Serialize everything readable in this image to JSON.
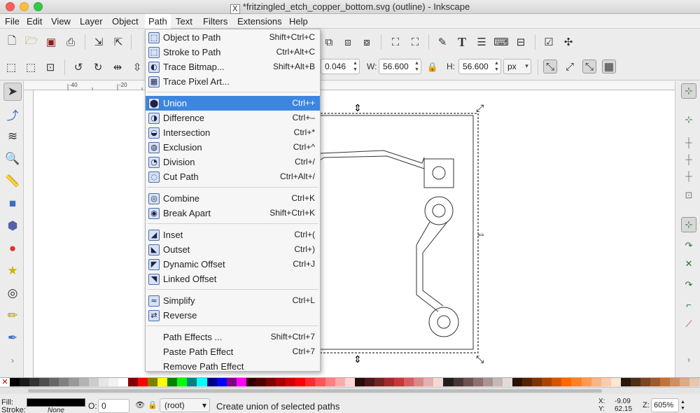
{
  "window": {
    "title": "*fritzingled_etch_copper_bottom.svg (outline) - Inkscape",
    "x11_glyph": "X",
    "traffic_colors": [
      "#fc605c",
      "#fdbc40",
      "#34c84a"
    ]
  },
  "menubar": [
    "File",
    "Edit",
    "View",
    "Layer",
    "Object",
    "Path",
    "Text",
    "Filters",
    "Extensions",
    "Help"
  ],
  "path_menu": {
    "items": [
      {
        "label": "Object to Path",
        "accel": "Shift+Ctrl+C",
        "icon": "object-to-path-icon"
      },
      {
        "label": "Stroke to Path",
        "accel": "Ctrl+Alt+C",
        "icon": "stroke-to-path-icon"
      },
      {
        "label": "Trace Bitmap...",
        "accel": "Shift+Alt+B",
        "icon": "trace-bitmap-icon"
      },
      {
        "label": "Trace Pixel Art...",
        "accel": "",
        "icon": "trace-pixel-art-icon"
      },
      {
        "label": "Union",
        "accel": "Ctrl++",
        "icon": "union-icon"
      },
      {
        "label": "Difference",
        "accel": "Ctrl+–",
        "icon": "difference-icon"
      },
      {
        "label": "Intersection",
        "accel": "Ctrl+*",
        "icon": "intersection-icon"
      },
      {
        "label": "Exclusion",
        "accel": "Ctrl+^",
        "icon": "exclusion-icon"
      },
      {
        "label": "Division",
        "accel": "Ctrl+/",
        "icon": "division-icon"
      },
      {
        "label": "Cut Path",
        "accel": "Ctrl+Alt+/",
        "icon": "cut-path-icon"
      },
      {
        "label": "Combine",
        "accel": "Ctrl+K",
        "icon": "combine-icon"
      },
      {
        "label": "Break Apart",
        "accel": "Shift+Ctrl+K",
        "icon": "break-apart-icon"
      },
      {
        "label": "Inset",
        "accel": "Ctrl+(",
        "icon": "inset-icon"
      },
      {
        "label": "Outset",
        "accel": "Ctrl+)",
        "icon": "outset-icon"
      },
      {
        "label": "Dynamic Offset",
        "accel": "Ctrl+J",
        "icon": "dynamic-offset-icon"
      },
      {
        "label": "Linked Offset",
        "accel": "",
        "icon": "linked-offset-icon"
      },
      {
        "label": "Simplify",
        "accel": "Ctrl+L",
        "icon": "simplify-icon"
      },
      {
        "label": "Reverse",
        "accel": "",
        "icon": "reverse-icon"
      },
      {
        "label": "Path Effects ...",
        "accel": "Shift+Ctrl+7",
        "icon": ""
      },
      {
        "label": "Paste Path Effect",
        "accel": "Ctrl+7",
        "icon": ""
      },
      {
        "label": "Remove Path Effect",
        "accel": "",
        "icon": ""
      }
    ],
    "highlighted": "Union",
    "highlight_color": "#3d86e0"
  },
  "toolbar_controls": {
    "x_value": "0.046",
    "w_label": "W:",
    "w_value": "56.600",
    "h_label": "H:",
    "h_value": "56.600",
    "unit": "px"
  },
  "ruler_labels": [
    "-40",
    "-20"
  ],
  "status": {
    "fill_label": "Fill:",
    "stroke_label": "Stroke:",
    "stroke_value": "None",
    "opacity_label": "O:",
    "opacity_value": "0",
    "layer": "(root)",
    "message": "Create union of selected paths",
    "x_label": "X:",
    "x_value": "-9.09",
    "y_label": "Y:",
    "y_value": "62.15",
    "zoom_label": "Z:",
    "zoom_value": "605%"
  },
  "palette": [
    "#000000",
    "#1a1a1a",
    "#333333",
    "#4d4d4d",
    "#666666",
    "#808080",
    "#999999",
    "#b3b3b3",
    "#cccccc",
    "#e6e6e6",
    "#f2f2f2",
    "#ffffff",
    "#800000",
    "#ff0000",
    "#808000",
    "#ffff00",
    "#008000",
    "#00ff00",
    "#008080",
    "#00ffff",
    "#000080",
    "#0000ff",
    "#800080",
    "#ff00ff",
    "#2b0000",
    "#550000",
    "#800000",
    "#aa0000",
    "#d40000",
    "#ff0000",
    "#ff2a2a",
    "#ff5555",
    "#ff8080",
    "#ffaaaa",
    "#ffd5d5",
    "#280b0b",
    "#501616",
    "#782121",
    "#a02c2c",
    "#c83737",
    "#d35f5f",
    "#de8787",
    "#e9afaf",
    "#f4d7d7",
    "#241c1c",
    "#483737",
    "#6c5353",
    "#916f6f",
    "#ac9393",
    "#c8b7b7",
    "#e3dbdb",
    "#2b1100",
    "#552200",
    "#803300",
    "#aa4400",
    "#d45500",
    "#ff6600",
    "#ff7f2a",
    "#ff9955",
    "#ffb380",
    "#ffccaa",
    "#ffe6d5",
    "#28170b",
    "#502d16",
    "#784421",
    "#a05a2c",
    "#c87137",
    "#d38d5f",
    "#deaa87",
    "#e9c6af"
  ]
}
